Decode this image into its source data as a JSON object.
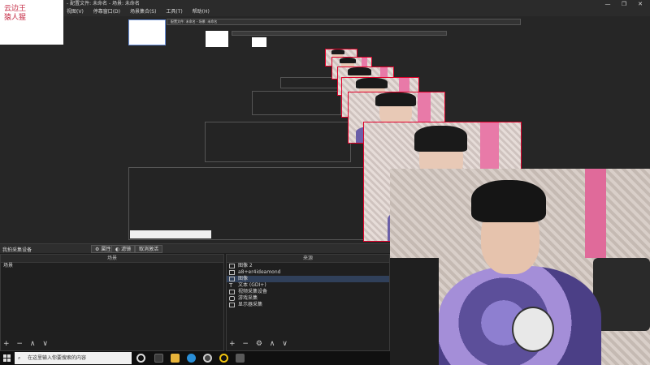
{
  "window": {
    "title": "- 配置文件: 未命名 - 场景: 未命名",
    "controls": [
      "—",
      "❐",
      "✕"
    ]
  },
  "menu": {
    "items": [
      "视图(V)",
      "停靠窗口(D)",
      "场景集合(S)",
      "工具(T)",
      "帮助(H)"
    ]
  },
  "logo": {
    "line1": "云边王",
    "line2": "猿人猩"
  },
  "nested_preview": {
    "nested_window_title": "配置文件: 未命名 - 场景: 未命名"
  },
  "dock": {
    "source_label": "我拍采集设备",
    "properties_button": "属性",
    "filters_button": "滤镜",
    "deactivate_button": "取消激活"
  },
  "scenes_panel": {
    "header": "场景",
    "items": [
      "场景"
    ],
    "controls": [
      "+",
      "−",
      "∧",
      "∨"
    ]
  },
  "sources_panel": {
    "header": "来源",
    "items": [
      {
        "label": "图像 2",
        "icon": "image-icon",
        "selected": false
      },
      {
        "label": "a8+er4ideamond",
        "icon": "image-icon",
        "selected": false
      },
      {
        "label": "图像",
        "icon": "image-icon",
        "selected": true
      },
      {
        "label": "文本 (GDI+)",
        "icon": "text-icon",
        "selected": false
      },
      {
        "label": "视频采集设备",
        "icon": "camera-icon",
        "selected": false
      },
      {
        "label": "游戏采集",
        "icon": "gamepad-icon",
        "selected": false
      },
      {
        "label": "显示器采集",
        "icon": "monitor-icon",
        "selected": false
      }
    ],
    "controls": [
      "+",
      "−",
      "⚙",
      "∧",
      "∨"
    ]
  },
  "taskbar": {
    "search_placeholder": "在这里输入你要搜索的内容",
    "icons": [
      "windows-start-icon",
      "task-view-icon",
      "file-explorer-icon",
      "edge-icon",
      "obs-icon",
      "obs-alt-icon",
      "app-icon"
    ]
  },
  "colors": {
    "accent_red": "#e0002a",
    "selection": "#30405a",
    "panel_bg": "#1f1f1f"
  }
}
